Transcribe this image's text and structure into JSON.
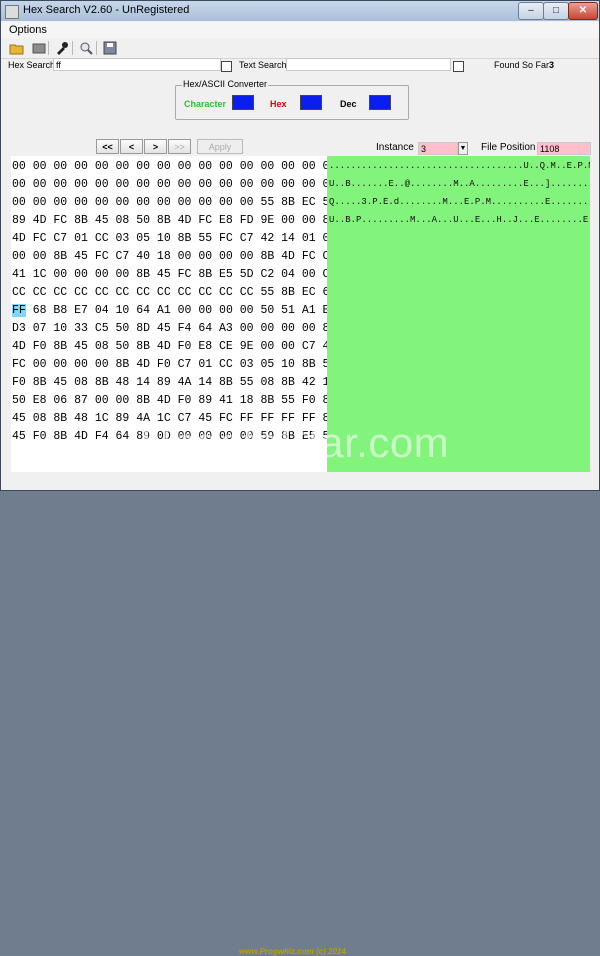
{
  "window": {
    "title": "Hex Search V2.60 - UnRegistered"
  },
  "menu": {
    "options": "Options"
  },
  "toolbar": {
    "icons": [
      "open-icon",
      "folder-icon",
      "tool-icon",
      "search-icon",
      "save-icon"
    ]
  },
  "search": {
    "hex_label": "Hex Search",
    "hex_value": "ff",
    "text_label": "Text Search",
    "text_value": "",
    "found_label": "Found So Far",
    "found_value": "3"
  },
  "converter": {
    "title": "Hex/ASCII Converter",
    "character_label": "Character",
    "hex_label": "Hex",
    "dec_label": "Dec",
    "swatch_color": "#0b1ef0"
  },
  "nav": {
    "first": "<<",
    "prev": "<",
    "next": ">",
    "last": ">>",
    "apply": "Apply"
  },
  "instance": {
    "label": "Instance",
    "value": "3"
  },
  "file_position": {
    "label": "File Position",
    "value": "1108"
  },
  "hex_rows": [
    "00 00 00 00 00 00 00 00 00 00 00 00 00 00 00 00",
    "00 00 00 00 00 00 00 00 00 00 00 00 00 00 00 00",
    "00 00 00 00 00 00 00 00 00 00 00 00 55 8B EC 51",
    "89 4D FC 8B 45 08 50 8B 4D FC E8 FD 9E 00 00 8B",
    "4D FC C7 01 CC 03 05 10 8B 55 FC C7 42 14 01 00",
    "00 00 8B 45 FC C7 40 18 00 00 00 00 8B 4D FC C7",
    "41 1C 00 00 00 00 8B 45 FC 8B E5 5D C2 04 00 CC",
    "CC CC CC CC CC CC CC CC CC CC CC CC 55 8B EC 6A",
    "FF 68 B8 E7 04 10 64 A1 00 00 00 00 50 51 A1 EC",
    "D3 07 10 33 C5 50 8D 45 F4 64 A3 00 00 00 00 89",
    "4D F0 8B 45 08 50 8B 4D F0 E8 CE 9E 00 00 C7 45",
    "FC 00 00 00 00 8B 4D F0 C7 01 CC 03 05 10 8B 55",
    "F0 8B 45 08 8B 48 14 89 4A 14 8B 55 08 8B 42 18",
    "50 E8 06 87 00 00 8B 4D F0 89 41 18 8B 55 F0 8B",
    "45 08 8B 48 1C 89 4A 1C C7 45 FC FF FF FF FF 8B",
    "45 F0 8B 4D F4 64 89 0D 00 00 00 00 59 8B E5 5D"
  ],
  "ascii_rows": [
    "....................................U..Q.M..E.P.M.......M.........",
    "U..B.......E..@........M..A.........E...]..............U...",
    "Q.....3.P.E.d........M...E.P.M..........E.........M..........U...E...H..J..",
    "U..B.P.........M...A...U...E...H..J...E........E...M..d.........Y...]"
  ],
  "ascii_cursor_char": "h",
  "footer": "www.Progwhiz.com (c) 2014",
  "watermark": "UpdateStar.com"
}
